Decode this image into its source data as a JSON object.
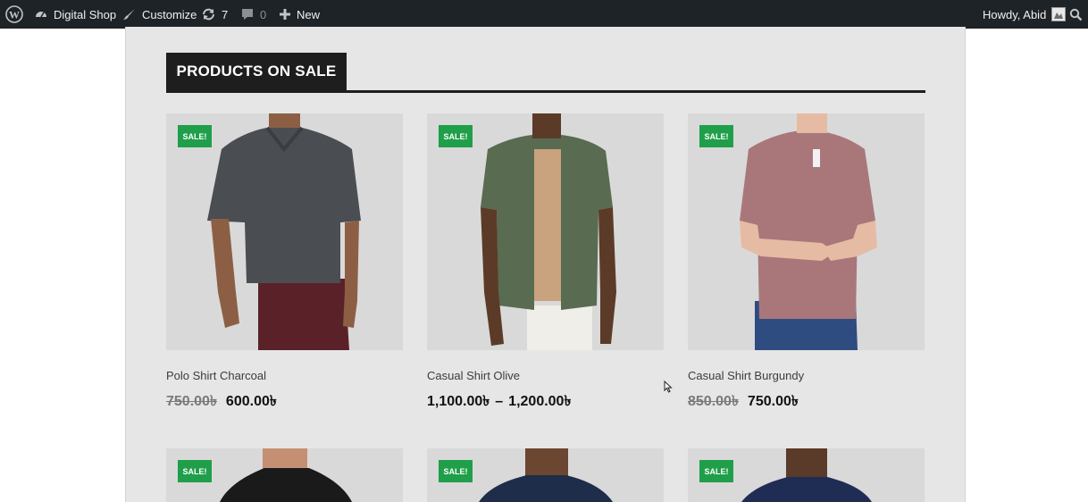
{
  "adminbar": {
    "site_name": "Digital Shop",
    "customize": "Customize",
    "updates_count": "7",
    "comments_count": "0",
    "new_label": "New",
    "greeting": "Howdy, Abid"
  },
  "section": {
    "title": "PRODUCTS ON SALE"
  },
  "products": [
    {
      "badge": "SALE!",
      "name": "Polo Shirt Charcoal",
      "old_price": "750.00৳",
      "price": "600.00৳",
      "shirt_color": "#4a4d52",
      "pants_color": "#5a2228"
    },
    {
      "badge": "SALE!",
      "name": "Casual Shirt Olive",
      "price_from": "1,100.00৳",
      "sep": "–",
      "price_to": "1,200.00৳",
      "shirt_color": "#596b50",
      "pants_color": "#efeee8"
    },
    {
      "badge": "SALE!",
      "name": "Casual Shirt Burgundy",
      "old_price": "850.00৳",
      "price": "750.00৳",
      "shirt_color": "#a9777a",
      "pants_color": "#2f4c80"
    },
    {
      "badge": "SALE!",
      "shirt_color": "#1a1a1a"
    },
    {
      "badge": "SALE!",
      "shirt_color": "#1d2d4a"
    },
    {
      "badge": "SALE!",
      "shirt_color": "#1f2d55"
    }
  ]
}
